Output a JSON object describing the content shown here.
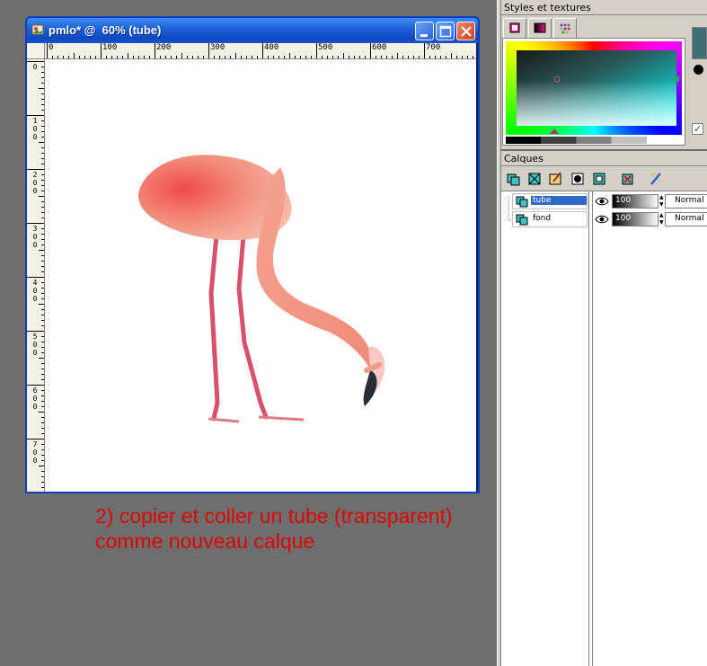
{
  "window": {
    "title": "pmlo* @  60% (tube)",
    "ruler_top_labels": [
      "0",
      "100",
      "200",
      "300",
      "400",
      "500",
      "600",
      "700"
    ],
    "ruler_left_labels": [
      "0",
      "100",
      "200",
      "300",
      "400",
      "500",
      "600",
      "700"
    ]
  },
  "caption": {
    "line1": "2) copier et coller un tube (transparent)",
    "line2": "comme nouveau calque"
  },
  "styles_palette": {
    "title": "Styles et textures",
    "tabs": [
      "color-tab",
      "gradient-tab",
      "pattern-tab"
    ],
    "foreground_color": "#3f6f73"
  },
  "layers_palette": {
    "title": "Calques",
    "layers": [
      {
        "name": "tube",
        "opacity": "100",
        "blend": "Normal",
        "selected": true
      },
      {
        "name": "fond",
        "opacity": "100",
        "blend": "Normal",
        "selected": false
      }
    ]
  }
}
